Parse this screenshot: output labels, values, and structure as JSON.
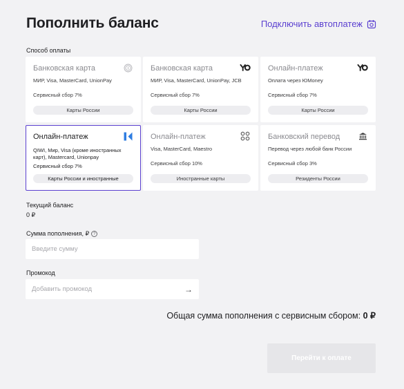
{
  "page": {
    "title": "Пополнить баланс",
    "autopay_link": "Подключить автоплатеж",
    "accent_color": "#5a3fd0"
  },
  "payment_method": {
    "section_label": "Способ оплаты",
    "cards": [
      {
        "title": "Банковская карта",
        "desc": "МИР, Visa, MasterCard, UnionPay",
        "fee": "Сервисный сбор 7%",
        "tag": "Карты России",
        "icon": "fingerprint-icon",
        "selected": false
      },
      {
        "title": "Банковская карта",
        "desc": "МИР, Visa, MasterCard, UnionPay, JCB",
        "fee": "Сервисный сбор 7%",
        "tag": "Карты России",
        "icon": "yoomoney-icon",
        "selected": false
      },
      {
        "title": "Онлайн-платеж",
        "desc": "Оплата через ЮMoney",
        "fee": "Сервисный сбор 7%",
        "tag": "Карты России",
        "icon": "yoomoney-icon",
        "selected": false
      },
      {
        "title": "Онлайн-платеж",
        "desc": "QIWI, Мир, Visa (кроме иностранных карт), Mastercard, Unionpay",
        "fee": "Сервисный сбор 7%",
        "tag": "Карты России и иностранные",
        "icon": "k-flag-icon",
        "selected": true
      },
      {
        "title": "Онлайн-платеж",
        "desc": "Visa, MasterCard, Maestro",
        "fee": "Сервисный сбор 10%",
        "tag": "Иностранные карты",
        "icon": "dots-icon",
        "selected": false
      },
      {
        "title": "Банковский перевод",
        "desc": "Перевод через любой банк России",
        "fee": "Сервисный сбор 3%",
        "tag": "Резиденты России",
        "icon": "bank-icon",
        "selected": false
      }
    ]
  },
  "balance": {
    "label": "Текущий баланс",
    "value": "0 ₽"
  },
  "amount": {
    "label": "Сумма пополнения, ₽",
    "help": "?",
    "placeholder": "Введите сумму"
  },
  "promo": {
    "label": "Промокод",
    "placeholder": "Добавить промокод",
    "arrow": "→"
  },
  "total": {
    "label": "Общая сумма пополнения с сервисным сбором:",
    "value": "0 ₽"
  },
  "submit": {
    "label": "Перейти к оплате"
  }
}
